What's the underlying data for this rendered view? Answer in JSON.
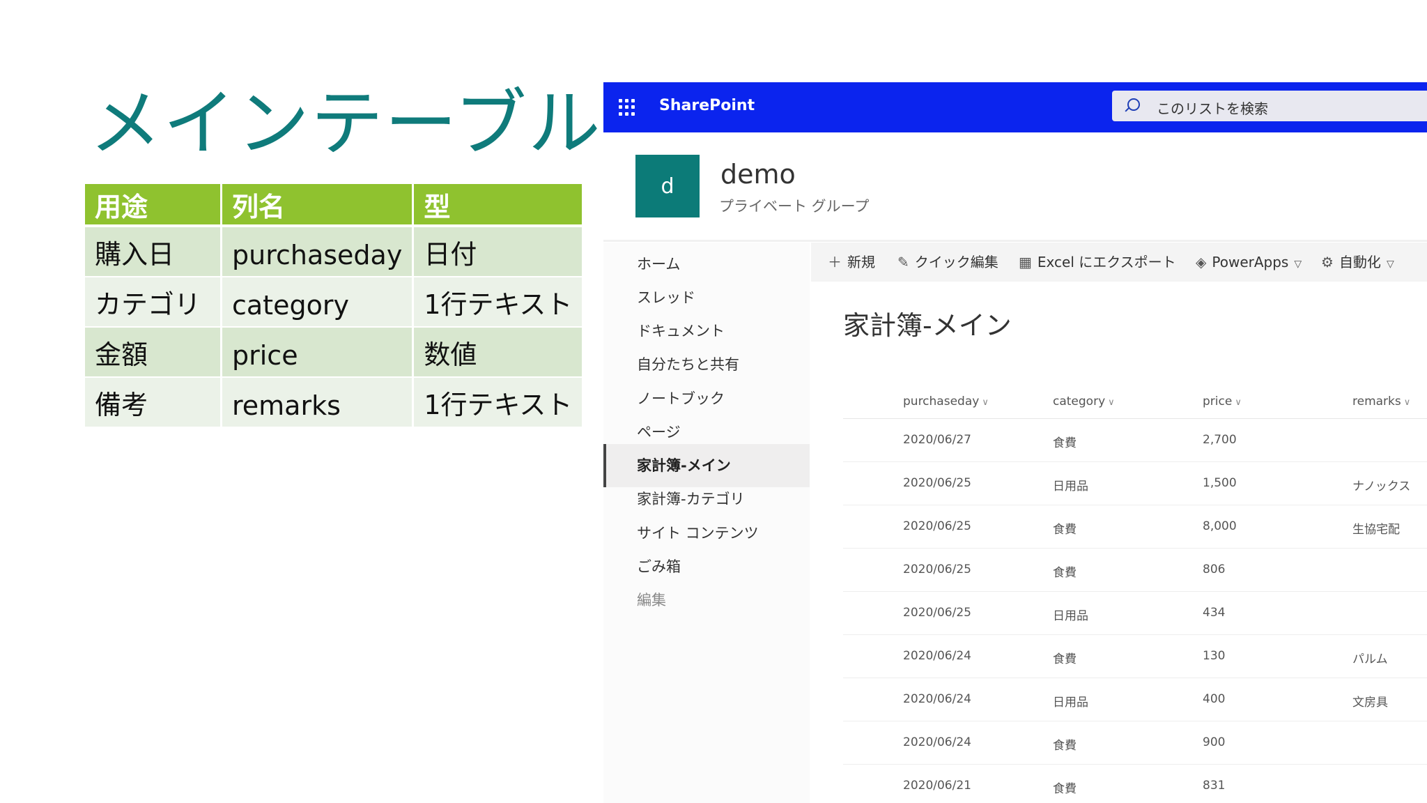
{
  "slide": {
    "title": "メインテーブル"
  },
  "schema_table": {
    "headers": [
      "用途",
      "列名",
      "型"
    ],
    "rows": [
      [
        "購入日",
        "purchaseday",
        "日付"
      ],
      [
        "カテゴリ",
        "category",
        "1行テキスト"
      ],
      [
        "金額",
        "price",
        "数値"
      ],
      [
        "備考",
        "remarks",
        "1行テキスト"
      ]
    ]
  },
  "sharepoint": {
    "brand": "SharePoint",
    "search_placeholder": "このリストを検索",
    "site_logo_letter": "d",
    "site_name": "demo",
    "site_description": "プライベート グループ",
    "nav": [
      "ホーム",
      "スレッド",
      "ドキュメント",
      "自分たちと共有",
      "ノートブック",
      "ページ",
      "家計簿-メイン",
      "家計簿-カテゴリ",
      "サイト コンテンツ",
      "ごみ箱",
      "編集"
    ],
    "nav_active_index": 6,
    "commands": {
      "new": "新規",
      "quick_edit": "クイック編集",
      "export": "Excel にエクスポート",
      "powerapps": "PowerApps",
      "automate": "自動化"
    },
    "list_title": "家計簿-メイン",
    "columns": [
      "purchaseday",
      "category",
      "price",
      "remarks"
    ],
    "rows": [
      [
        "2020/06/27",
        "食費",
        "2,700",
        ""
      ],
      [
        "2020/06/25",
        "日用品",
        "1,500",
        "ナノックス"
      ],
      [
        "2020/06/25",
        "食費",
        "8,000",
        "生協宅配"
      ],
      [
        "2020/06/25",
        "食費",
        "806",
        ""
      ],
      [
        "2020/06/25",
        "日用品",
        "434",
        ""
      ],
      [
        "2020/06/24",
        "食費",
        "130",
        "パルム"
      ],
      [
        "2020/06/24",
        "日用品",
        "400",
        "文房具"
      ],
      [
        "2020/06/24",
        "食費",
        "900",
        ""
      ],
      [
        "2020/06/21",
        "食費",
        "831",
        ""
      ]
    ],
    "colors": {
      "topbar": "#0b24ee",
      "site_logo": "#0c7b78"
    }
  }
}
